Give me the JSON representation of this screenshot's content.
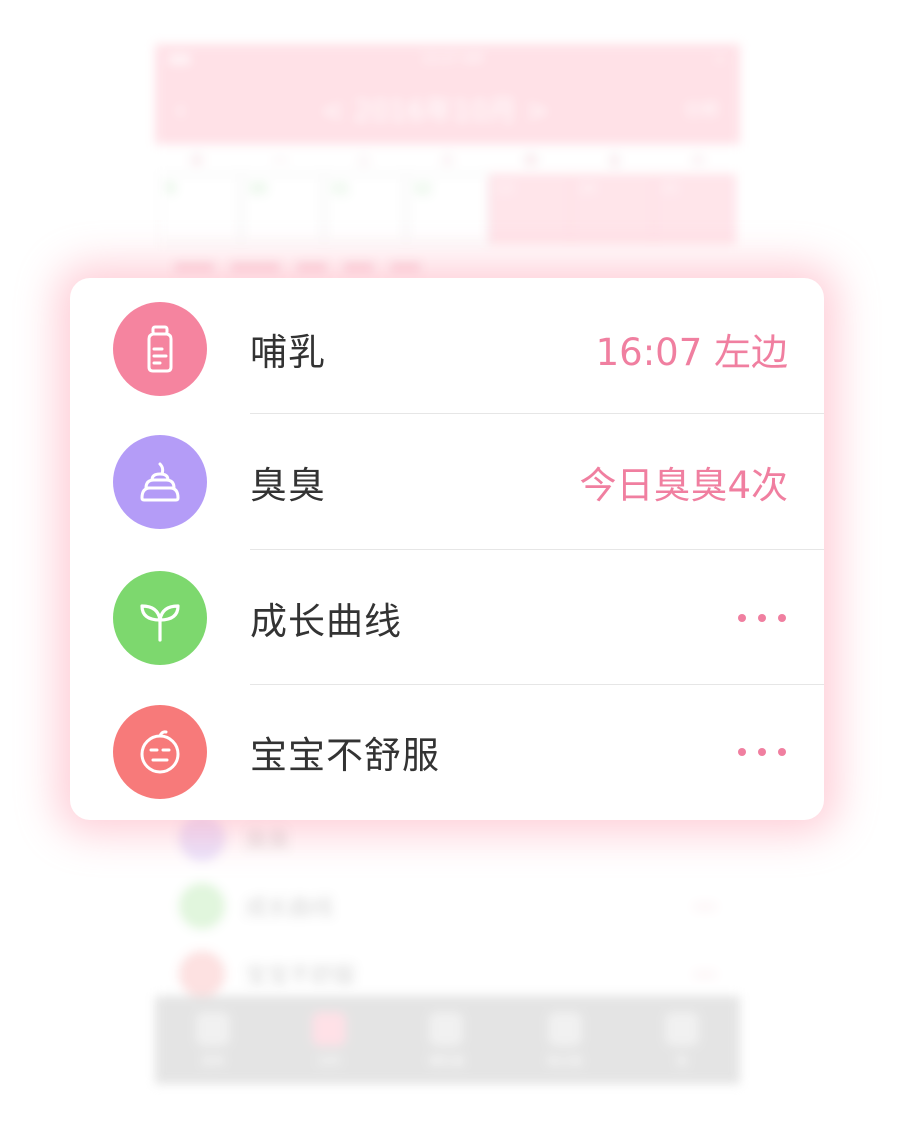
{
  "background": {
    "status_time": "13:27 AM",
    "nav_title": "< 2016年10月 >",
    "nav_right": "分析",
    "weekdays": [
      "日",
      "一",
      "二",
      "三",
      "四",
      "五",
      "六"
    ],
    "days": [
      "9",
      "10",
      "11",
      "12",
      "13",
      "14",
      "15"
    ],
    "tabs": [
      "菜单",
      "日历",
      "哺乳篇",
      "每日报",
      "我"
    ],
    "list": [
      "臭臭",
      "成长曲线",
      "宝宝不舒服"
    ]
  },
  "popup": {
    "rows": [
      {
        "label": "哺乳",
        "value": "16:07 左边",
        "icon": "baby-bottle-icon",
        "icon_color": "#f5849f"
      },
      {
        "label": "臭臭",
        "value": "今日臭臭4次",
        "icon": "poop-icon",
        "icon_color": "#b49cf7"
      },
      {
        "label": "成长曲线",
        "value": "",
        "icon": "sprout-icon",
        "icon_color": "#7dd86e"
      },
      {
        "label": "宝宝不舒服",
        "value": "",
        "icon": "sick-face-icon",
        "icon_color": "#f77a7a"
      }
    ],
    "accent_color": "#f07fa0",
    "label_color": "#333333"
  }
}
